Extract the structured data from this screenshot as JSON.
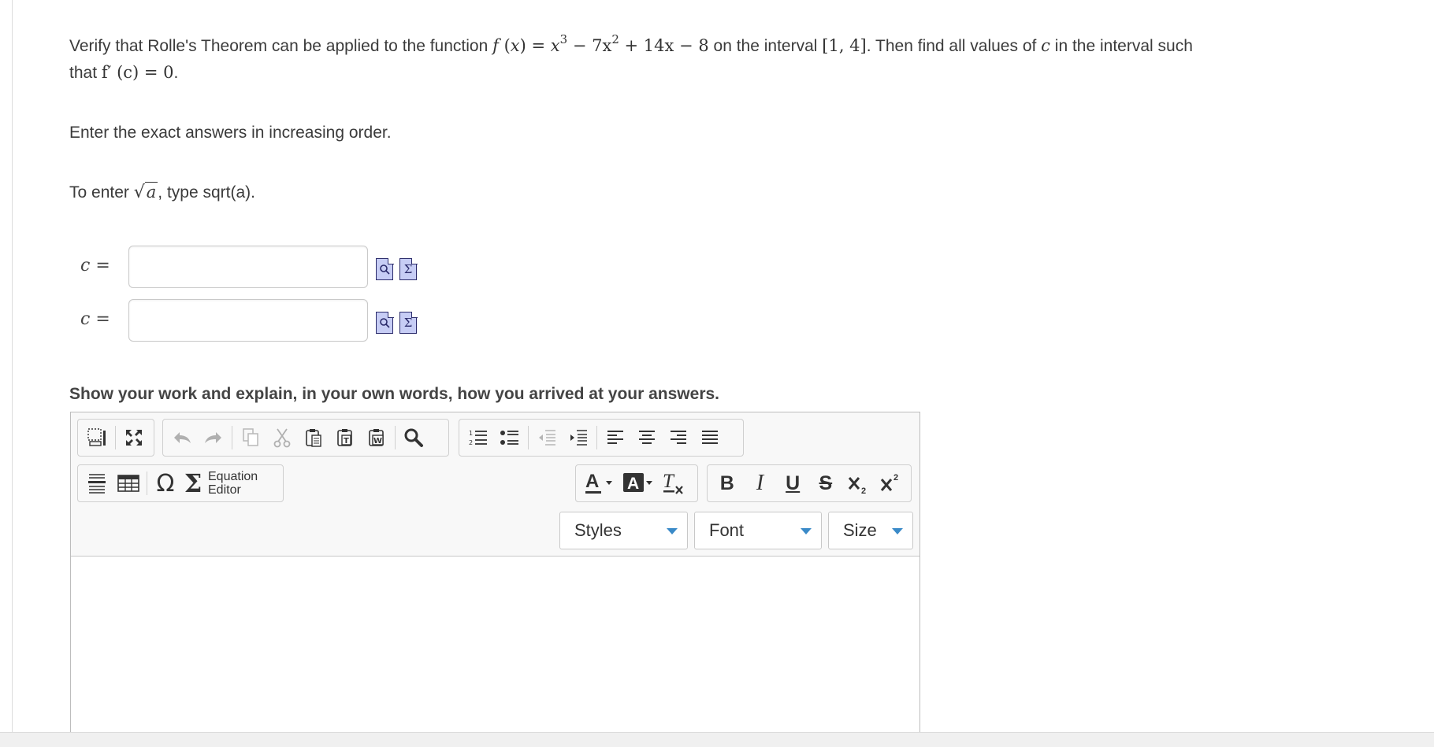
{
  "question": {
    "intro": "Verify that Rolle's Theorem can be applied to the function ",
    "function_name": "f",
    "function_var": "x",
    "function_expr_a": "x",
    "function_exp_a": "3",
    "function_expr_b": " − 7x",
    "function_exp_b": "2",
    "function_expr_c": " + 14x − 8",
    "interval_text": " on the interval ",
    "interval": "[1, 4]",
    "then_text": ". Then find all values of ",
    "c_var": "c",
    "tail_text": " in the interval such",
    "line2_prefix": "that ",
    "derivative": "f′ (c) = 0",
    "line2_suffix": "."
  },
  "instructions": {
    "exact": "Enter the exact answers in increasing order.",
    "sqrt_prefix": "To enter ",
    "sqrt_symbol": "√",
    "sqrt_var": "a",
    "sqrt_suffix": ", type sqrt(a)."
  },
  "answers": [
    {
      "label_var": "c",
      "label_eq": " =",
      "value": "",
      "placeholder": ""
    },
    {
      "label_var": "c",
      "label_eq": " =",
      "value": "",
      "placeholder": ""
    }
  ],
  "work_prompt": "Show your work and explain, in your own words, how you arrived at your answers.",
  "editor": {
    "equation_editor_line1": "Equation",
    "equation_editor_line2": "Editor",
    "styles_label": "Styles",
    "font_label": "Font",
    "size_label": "Size",
    "body_text": ""
  },
  "colors": {
    "icon_fill": "#c7cdf5",
    "icon_stroke": "#2a2a6a",
    "dropdown_caret": "#3a8ac8",
    "text": "#3b3b3b"
  }
}
